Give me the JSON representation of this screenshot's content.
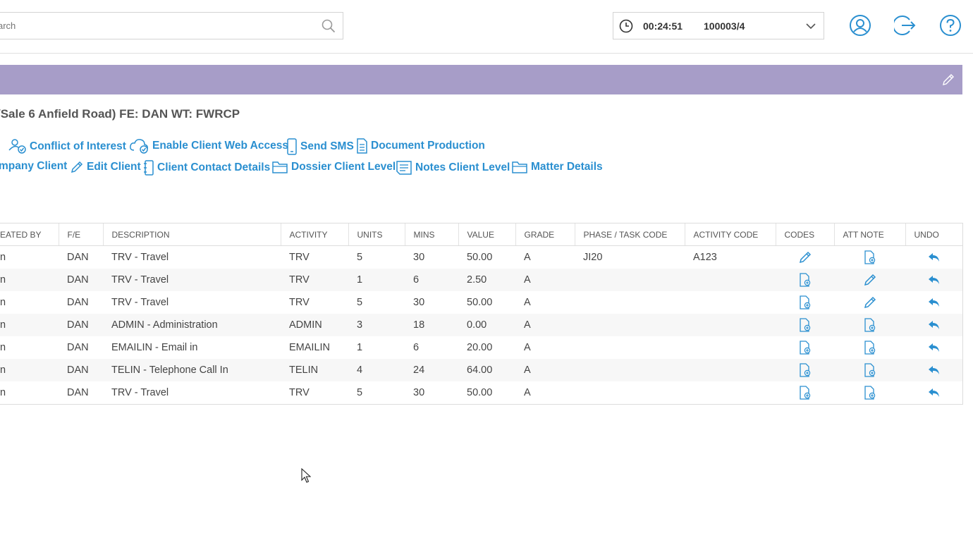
{
  "search": {
    "placeholder": "arch",
    "value": ""
  },
  "timer": {
    "time": "00:24:51",
    "matter": "100003/4"
  },
  "header_icons": [
    "user-circle-icon",
    "logout-icon",
    "help-icon"
  ],
  "colors": {
    "band": "#a79dc8",
    "link": "#2a8fd0",
    "accent": "#2a8fd0"
  },
  "matter_title": "/Sale 6 Anfield Road) FE: DAN WT: FWRCP",
  "actions_row1": [
    {
      "label": "",
      "icon": "partial-icon"
    },
    {
      "label": "Conflict of Interest",
      "icon": "conflict-icon"
    },
    {
      "label": "Enable Client Web Access",
      "icon": "cloud-check-icon"
    },
    {
      "label": "Send SMS",
      "icon": "phone-icon"
    },
    {
      "label": "Document Production",
      "icon": "document-icon"
    }
  ],
  "actions_row2": [
    {
      "label": "mpany Client",
      "icon": ""
    },
    {
      "label": "Edit Client",
      "icon": "pencil-icon"
    },
    {
      "label": "Client Contact Details",
      "icon": "contact-book-icon"
    },
    {
      "label": "Dossier Client Level",
      "icon": "folder-icon"
    },
    {
      "label": "Notes Client Level",
      "icon": "notes-icon"
    },
    {
      "label": "Matter Details",
      "icon": "folder-icon"
    }
  ],
  "table": {
    "headers": [
      "EATED BY",
      "F/E",
      "DESCRIPTION",
      "ACTIVITY",
      "UNITS",
      "MINS",
      "VALUE",
      "GRADE",
      "PHASE / TASK CODE",
      "ACTIVITY CODE",
      "CODES",
      "ATT NOTE",
      "UNDO"
    ],
    "rows": [
      {
        "created_by": "n",
        "fe": "DAN",
        "description": "TRV - Travel",
        "activity": "TRV",
        "units": "5",
        "mins": "30",
        "value": "50.00",
        "grade": "A",
        "phase": "JI20",
        "activity_code": "A123",
        "codes_icon": "pencil-icon",
        "att_icon": "add-document-icon"
      },
      {
        "created_by": "n",
        "fe": "DAN",
        "description": "TRV - Travel",
        "activity": "TRV",
        "units": "1",
        "mins": "6",
        "value": "2.50",
        "grade": "A",
        "phase": "",
        "activity_code": "",
        "codes_icon": "add-document-icon",
        "att_icon": "pencil-icon"
      },
      {
        "created_by": "n",
        "fe": "DAN",
        "description": "TRV - Travel",
        "activity": "TRV",
        "units": "5",
        "mins": "30",
        "value": "50.00",
        "grade": "A",
        "phase": "",
        "activity_code": "",
        "codes_icon": "add-document-icon",
        "att_icon": "pencil-icon"
      },
      {
        "created_by": "n",
        "fe": "DAN",
        "description": "ADMIN - Administration",
        "activity": "ADMIN",
        "units": "3",
        "mins": "18",
        "value": "0.00",
        "grade": "A",
        "phase": "",
        "activity_code": "",
        "codes_icon": "add-document-icon",
        "att_icon": "add-document-icon"
      },
      {
        "created_by": "n",
        "fe": "DAN",
        "description": "EMAILIN - Email in",
        "activity": "EMAILIN",
        "units": "1",
        "mins": "6",
        "value": "20.00",
        "grade": "A",
        "phase": "",
        "activity_code": "",
        "codes_icon": "add-document-icon",
        "att_icon": "add-document-icon"
      },
      {
        "created_by": "n",
        "fe": "DAN",
        "description": "TELIN - Telephone Call In",
        "activity": "TELIN",
        "units": "4",
        "mins": "24",
        "value": "64.00",
        "grade": "A",
        "phase": "",
        "activity_code": "",
        "codes_icon": "add-document-icon",
        "att_icon": "add-document-icon"
      },
      {
        "created_by": "n",
        "fe": "DAN",
        "description": "TRV - Travel",
        "activity": "TRV",
        "units": "5",
        "mins": "30",
        "value": "50.00",
        "grade": "A",
        "phase": "",
        "activity_code": "",
        "codes_icon": "add-document-icon",
        "att_icon": "add-document-icon"
      }
    ]
  }
}
